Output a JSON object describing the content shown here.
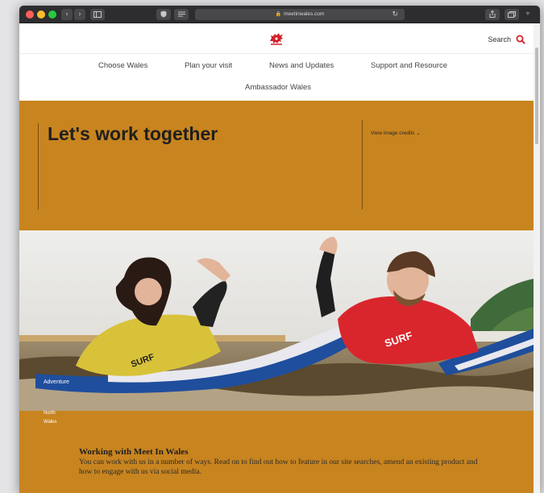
{
  "browser": {
    "url": "meetinwales.com",
    "back_glyph": "‹",
    "forward_glyph": "›"
  },
  "header": {
    "search_label": "Search"
  },
  "nav": {
    "items": [
      "Choose Wales",
      "Plan your visit",
      "News and Updates",
      "Support and Resource",
      "Ambassador Wales"
    ]
  },
  "hero": {
    "title": "Let's work together",
    "credits_label": "View image credits",
    "credits_glyph": "⌄"
  },
  "photo": {
    "tags": [
      "Adventure",
      "North",
      "Wales"
    ]
  },
  "intro": {
    "title": "Working with Meet In Wales",
    "body": "You can work with us in a number of ways. Read on to find out how to feature in our site searches, amend an existing product and how to engage with us via social media."
  },
  "colors": {
    "brand_red": "#d4202a",
    "band_orange": "#c8841f"
  }
}
